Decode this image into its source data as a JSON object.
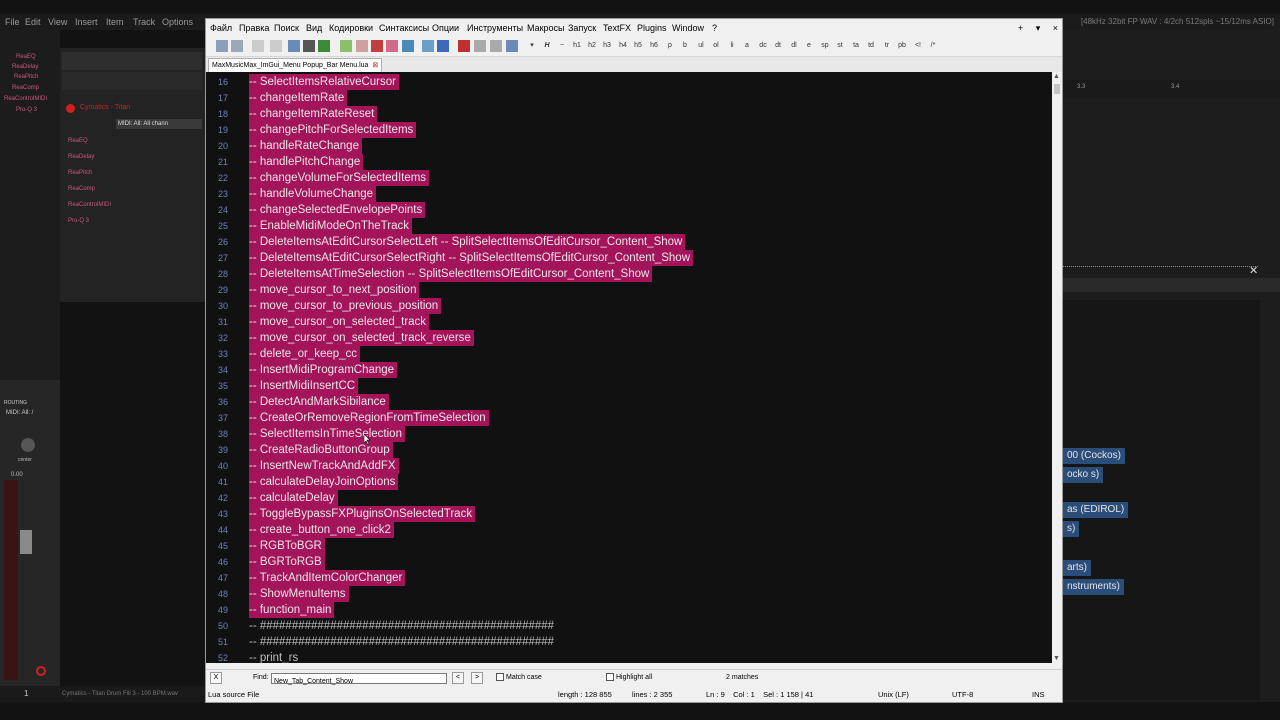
{
  "reaper": {
    "menu": [
      "File",
      "Edit",
      "View",
      "Insert",
      "Item",
      "Track",
      "Options"
    ],
    "status_text": "[48kHz 32bit FP WAV : 4/2ch 512spls ~15/12ms ASIO]",
    "fx_list": [
      "ReaEQ",
      "ReaDelay",
      "ReaPitch",
      "ReaComp",
      "ReaControlMIDI",
      "Pro-Q 3"
    ],
    "track_name": "Cymatics - Titan",
    "midi_input": "MIDI: All: All chann",
    "routing_label": "ROUTING",
    "midi_short": "MIDI: All: /",
    "center_label": "center",
    "volume_readout": "0.00",
    "track_number": "1",
    "bottom_item": "Cymatics - Titan Drum Fill 3 - 100 BPM.wav",
    "ruler_marks": [
      "3.3",
      "3.4"
    ],
    "routing_items": [
      "00 (Cockos)",
      "ocko s)",
      "as (EDIROL)",
      "s)",
      "arts)",
      "nstruments)"
    ]
  },
  "editor": {
    "menu": [
      "Файл",
      "Правка",
      "Поиск",
      "Вид",
      "Кодировки",
      "Синтаксисы",
      "Опции",
      "Инструменты",
      "Макросы",
      "Запуск",
      "TextFX",
      "Plugins",
      "Window",
      "?"
    ],
    "window_controls": [
      "+",
      "▾",
      "×"
    ],
    "toolbar_icons": [
      "save-icon",
      "save-all-icon",
      "cut-icon",
      "copy-icon",
      "paste-icon",
      "undo-icon",
      "redo-icon",
      "find-icon",
      "replace-icon",
      "zoom-icon",
      "run-icon",
      "macro-icon",
      "bold-icon",
      "italic-icon",
      "h1",
      "h2",
      "h3",
      "h4",
      "h5",
      "h6",
      "p",
      "b",
      "ul",
      "ol",
      "li",
      "a",
      "dc",
      "dt",
      "dl",
      "e",
      "sp",
      "st",
      "ta",
      "td",
      "tr",
      "pb",
      "</>",
      "/*"
    ],
    "toolbar_text": [
      "h1",
      "h2",
      "h3",
      "h4",
      "h5",
      "h6",
      "p",
      "b",
      "ul",
      "ol",
      "li",
      "a",
      "dc",
      "dt",
      "dl",
      "e",
      "sp",
      "st",
      "ta",
      "td",
      "tr",
      "pb",
      "<!",
      "/*"
    ],
    "tab_label": "MaxMusicMax_ImGui_Menu Popup_Bar Menu.lua",
    "tab_close": "⊠",
    "lines": [
      {
        "n": "16",
        "t": "-- SelectItemsRelativeCursor",
        "sel": true
      },
      {
        "n": "17",
        "t": "-- changeItemRate",
        "sel": true
      },
      {
        "n": "18",
        "t": "-- changeItemRateReset",
        "sel": true
      },
      {
        "n": "19",
        "t": "-- changePitchForSelectedItems",
        "sel": true
      },
      {
        "n": "20",
        "t": "-- handleRateChange",
        "sel": true
      },
      {
        "n": "21",
        "t": "-- handlePitchChange",
        "sel": true
      },
      {
        "n": "22",
        "t": "-- changeVolumeForSelectedItems",
        "sel": true
      },
      {
        "n": "23",
        "t": "-- handleVolumeChange",
        "sel": true
      },
      {
        "n": "24",
        "t": "-- changeSelectedEnvelopePoints",
        "sel": true
      },
      {
        "n": "25",
        "t": "-- EnableMidiModeOnTheTrack",
        "sel": true
      },
      {
        "n": "26",
        "t": "-- DeleteItemsAtEditCursorSelectLeft -- SplitSelectItemsOfEditCursor_Content_Show",
        "sel": true
      },
      {
        "n": "27",
        "t": "-- DeleteItemsAtEditCursorSelectRight -- SplitSelectItemsOfEditCursor_Content_Show",
        "sel": true
      },
      {
        "n": "28",
        "t": "-- DeleteItemsAtTimeSelection -- SplitSelectItemsOfEditCursor_Content_Show",
        "sel": true
      },
      {
        "n": "29",
        "t": "-- move_cursor_to_next_position",
        "sel": true
      },
      {
        "n": "30",
        "t": "-- move_cursor_to_previous_position",
        "sel": true
      },
      {
        "n": "31",
        "t": "-- move_cursor_on_selected_track",
        "sel": true
      },
      {
        "n": "32",
        "t": "-- move_cursor_on_selected_track_reverse",
        "sel": true
      },
      {
        "n": "33",
        "t": "-- delete_or_keep_cc",
        "sel": true
      },
      {
        "n": "34",
        "t": "-- InsertMidiProgramChange",
        "sel": true
      },
      {
        "n": "35",
        "t": "-- InsertMidiInsertCC",
        "sel": true
      },
      {
        "n": "36",
        "t": "-- DetectAndMarkSibilance",
        "sel": true
      },
      {
        "n": "37",
        "t": "-- CreateOrRemoveRegionFromTimeSelection",
        "sel": true
      },
      {
        "n": "38",
        "t": "-- SelectItemsInTimeSelection",
        "sel": true
      },
      {
        "n": "39",
        "t": "-- CreateRadioButtonGroup",
        "sel": true
      },
      {
        "n": "40",
        "t": "-- InsertNewTrackAndAddFX",
        "sel": true
      },
      {
        "n": "41",
        "t": "-- calculateDelayJoinOptions",
        "sel": true
      },
      {
        "n": "42",
        "t": "-- calculateDelay",
        "sel": true
      },
      {
        "n": "43",
        "t": "-- ToggleBypassFXPluginsOnSelectedTrack",
        "sel": true
      },
      {
        "n": "44",
        "t": "-- create_button_one_click2",
        "sel": true
      },
      {
        "n": "45",
        "t": "-- RGBToBGR",
        "sel": true
      },
      {
        "n": "46",
        "t": "-- BGRToRGB",
        "sel": true
      },
      {
        "n": "47",
        "t": "-- TrackAndItemColorChanger",
        "sel": true
      },
      {
        "n": "48",
        "t": "-- ShowMenuItems",
        "sel": true
      },
      {
        "n": "49",
        "t": "-- function_main",
        "sel": true
      },
      {
        "n": "50",
        "t": "-- ##############################################",
        "sel": false
      },
      {
        "n": "51",
        "t": "-- ##############################################",
        "sel": false
      },
      {
        "n": "52",
        "t": "-- print_rs",
        "sel": false
      }
    ],
    "find": {
      "close": "X",
      "label": "Find:",
      "value": "New_Tab_Content_Show",
      "prev": "<",
      "next": ">",
      "match_case": "Match case",
      "highlight_all": "Highlight all",
      "matches": "2 matches"
    },
    "status": {
      "filetype": "Lua source File",
      "length": "length : 128 855",
      "lines": "lines : 2 355",
      "position": "Ln : 9    Col : 1    Sel : 1 158 | 41",
      "eol": "Unix (LF)",
      "encoding": "UTF-8",
      "mode": "INS"
    }
  }
}
